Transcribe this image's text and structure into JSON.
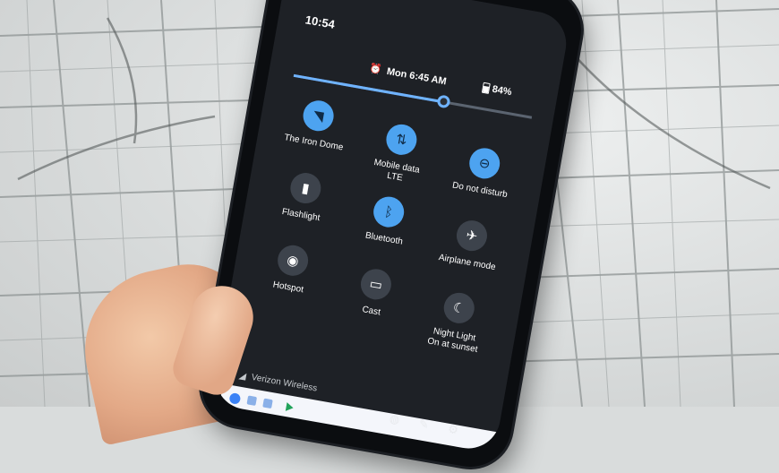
{
  "status_bar": {
    "time": "10:54"
  },
  "quick_settings": {
    "alarm": "Mon 6:45 AM",
    "battery": "84%",
    "brightness_level": 0.63,
    "tiles": [
      {
        "name": "wifi",
        "label": "The Iron Dome",
        "sublabel": "",
        "state": "on",
        "icon": "wifi-icon"
      },
      {
        "name": "mobile-data",
        "label": "Mobile data",
        "sublabel": "LTE",
        "state": "on",
        "icon": "mobile-data-icon"
      },
      {
        "name": "do-not-disturb",
        "label": "Do not disturb",
        "sublabel": "",
        "state": "on",
        "icon": "do-not-disturb-icon"
      },
      {
        "name": "flashlight",
        "label": "Flashlight",
        "sublabel": "",
        "state": "off",
        "icon": "flashlight-icon"
      },
      {
        "name": "bluetooth",
        "label": "Bluetooth",
        "sublabel": "",
        "state": "on",
        "icon": "bluetooth-icon"
      },
      {
        "name": "airplane-mode",
        "label": "Airplane mode",
        "sublabel": "",
        "state": "off",
        "icon": "airplane-icon"
      },
      {
        "name": "hotspot",
        "label": "Hotspot",
        "sublabel": "",
        "state": "off",
        "icon": "hotspot-icon"
      },
      {
        "name": "cast",
        "label": "Cast",
        "sublabel": "",
        "state": "off",
        "icon": "cast-icon"
      },
      {
        "name": "night-light",
        "label": "Night Light",
        "sublabel": "On at sunset",
        "state": "off",
        "icon": "moon-icon"
      }
    ]
  },
  "footer": {
    "carrier": "Verizon Wireless"
  },
  "colors": {
    "accent": "#4da3f0",
    "tile_off": "#3d434c",
    "panel": "#1e2126"
  }
}
